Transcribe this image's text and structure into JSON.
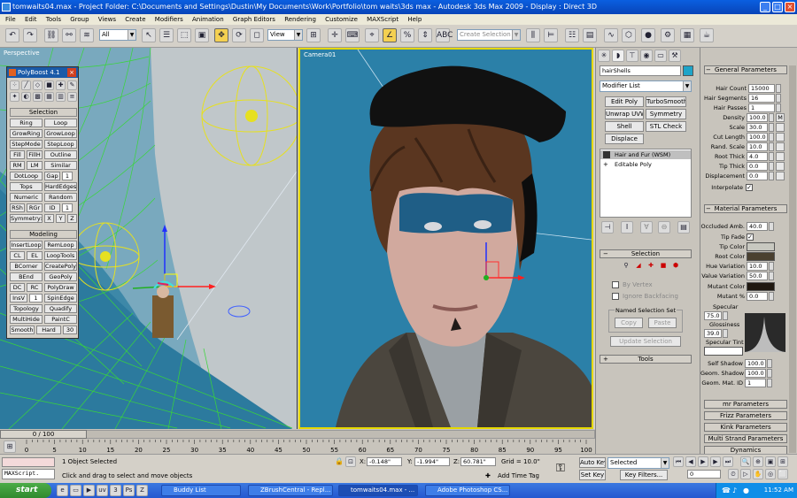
{
  "window": {
    "title": "tomwaits04.max  - Project Folder: C:\\Documents and Settings\\Dustin\\My Documents\\Work\\Portfolio\\tom waits\\3ds max    - Autodesk 3ds Max  2009     - Display : Direct 3D"
  },
  "menu": [
    "File",
    "Edit",
    "Tools",
    "Group",
    "Views",
    "Create",
    "Modifiers",
    "Animation",
    "Graph Editors",
    "Rendering",
    "Customize",
    "MAXScript",
    "Help"
  ],
  "toolbar": {
    "selection_filter": "All",
    "ref_coord": "View",
    "named_selection_placeholder": "Create Selection Set"
  },
  "viewports": {
    "left_label": "Perspective",
    "right_label": "Camera01"
  },
  "polyboost": {
    "title": "PolyBoost 4.1",
    "selection_header": "Selection",
    "selection_buttons": [
      "Ring",
      "Loop",
      "GrowRing",
      "GrowLoop",
      "StepMode",
      "StepLoop",
      "Fill",
      "FillH",
      "Outline",
      "RM",
      "LM",
      "Similar",
      "DotLoop",
      "Gap",
      "Tops",
      "HardEdges",
      "Numeric",
      "Random",
      "RSh",
      "RGr",
      "ID",
      "Symmetry:",
      "X",
      "Y",
      "Z"
    ],
    "gap_value": "1",
    "id_value": "1",
    "modeling_header": "Modeling",
    "modeling_buttons": [
      "InsertLoop",
      "RemLoop",
      "CL",
      "EL",
      "LoopTools",
      "BCorner",
      "CreatePoly",
      "BEnd",
      "GeoPoly",
      "DC",
      "RC",
      "PolyDraw",
      "InsV",
      "SpinEdge",
      "Topology",
      "Quadify",
      "MultiHide",
      "PaintC",
      "Smooth",
      "Hard",
      "30"
    ],
    "insv_value": "1"
  },
  "command_panel": {
    "object_name": "hairShells",
    "modifier_list": "Modifier List",
    "buttons": [
      "Edit Poly",
      "TurboSmooth",
      "Unwrap UVW",
      "Symmetry",
      "Shell",
      "STL Check",
      "Displace"
    ],
    "stack": [
      "Hair and Fur (WSM)",
      "Editable Poly"
    ],
    "selection_header": "Selection",
    "by_vertex": "By Vertex",
    "ignore_backfacing": "Ignore Backfacing",
    "named_sel_sets": "Named Selection Set",
    "copy": "Copy",
    "paste": "Paste",
    "update_selection": "Update Selection",
    "tools_header": "Tools"
  },
  "general_params": {
    "header": "General Parameters",
    "rows": [
      {
        "label": "Hair Count",
        "value": "15000"
      },
      {
        "label": "Hair Segments",
        "value": "16"
      },
      {
        "label": "Hair Passes",
        "value": "1"
      },
      {
        "label": "Density",
        "value": "100.0"
      },
      {
        "label": "Scale",
        "value": "30.0"
      },
      {
        "label": "Cut Length",
        "value": "100.0"
      },
      {
        "label": "Rand. Scale",
        "value": "10.0"
      },
      {
        "label": "Root Thick",
        "value": "4.0"
      },
      {
        "label": "Tip Thick",
        "value": "0.0"
      },
      {
        "label": "Displacement",
        "value": "0.0"
      }
    ],
    "m_label": "M",
    "interpolate": "Interpolate"
  },
  "material_params": {
    "header": "Material Parameters",
    "occluded_amb_label": "Occluded Amb.",
    "occluded_amb": "40.0",
    "tip_fade": "Tip Fade",
    "tip_color": "Tip Color",
    "root_color": "Root Color",
    "hue_variation_label": "Hue Variation",
    "hue_variation": "10.0",
    "value_variation_label": "Value Variation",
    "value_variation": "50.0",
    "mutant_color": "Mutant Color",
    "mutant_pct_label": "Mutant %",
    "mutant_pct": "0.0",
    "specular_label": "Specular",
    "specular": "75.0",
    "glossiness_label": "Glossiness",
    "glossiness": "39.0",
    "specular_tint": "Specular Tint",
    "self_shadow_label": "Self Shadow",
    "self_shadow": "100.0",
    "geom_shadow_label": "Geom. Shadow",
    "geom_shadow": "100.0",
    "geom_mat_id_label": "Geom. Mat. ID",
    "geom_mat_id": "1",
    "colors": {
      "tip": "#c8c8c0",
      "root": "#4a4030",
      "mutant": "#201810",
      "specular_tint": "#ffffff"
    }
  },
  "rollouts": [
    "mr Parameters",
    "Frizz Parameters",
    "Kink Parameters",
    "Multi Strand Parameters",
    "Dynamics"
  ],
  "timeline": {
    "frame": "0 / 100",
    "ticks": [
      "0",
      "5",
      "10",
      "15",
      "20",
      "25",
      "30",
      "35",
      "40",
      "45",
      "50",
      "55",
      "60",
      "65",
      "70",
      "75",
      "80",
      "85",
      "90",
      "95",
      "100"
    ]
  },
  "status": {
    "maxscript": "MAXScript.",
    "selected": "1 Object Selected",
    "prompt": "Click and drag to select and move objects",
    "x": "-0.148\"",
    "y": "-1.994\"",
    "z": "60.781\"",
    "grid": "Grid = 10.0\"",
    "add_time_tag": "Add Time Tag",
    "auto_key": "Auto Key",
    "set_key": "Set Key",
    "selected_combo": "Selected",
    "key_filters": "Key Filters...",
    "frame_field": "0"
  },
  "taskbar": {
    "start": "start",
    "items": [
      "Buddy List",
      "ZBrushCentral - Repl...",
      "tomwaits04.max - ...",
      "Adobe Photoshop CS..."
    ],
    "time": "11:52 AM"
  }
}
